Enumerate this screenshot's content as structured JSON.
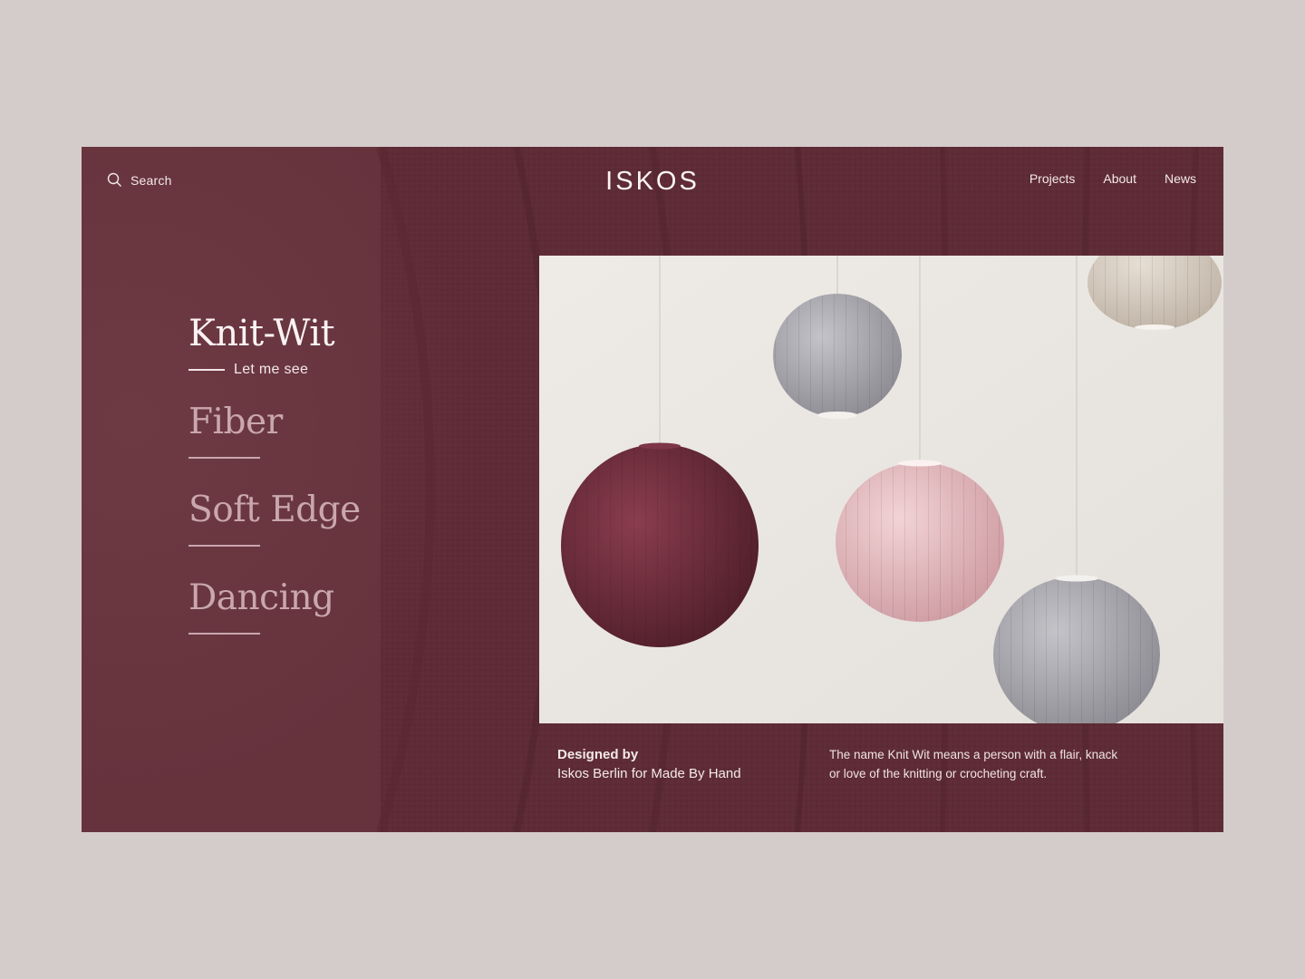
{
  "header": {
    "search_label": "Search",
    "logo": "ISKOS",
    "nav": [
      "Projects",
      "About",
      "News"
    ]
  },
  "menu": {
    "active": {
      "title": "Knit-Wit",
      "cta": "Let me see"
    },
    "items": [
      {
        "label": "Fiber"
      },
      {
        "label": "Soft Edge"
      },
      {
        "label": "Dancing"
      }
    ]
  },
  "feature": {
    "designed_label": "Designed by",
    "designer": "Iskos Berlin for Made By Hand",
    "description": "The name Knit Wit means a person with a flair, knack or love of the knitting or crocheting craft."
  },
  "colors": {
    "page_bg": "#d4cccb",
    "panel_bg": "#66333d",
    "panel_dark": "#5c2a34",
    "text_light": "#f3e9ea",
    "text_muted": "#c9a7ad"
  }
}
